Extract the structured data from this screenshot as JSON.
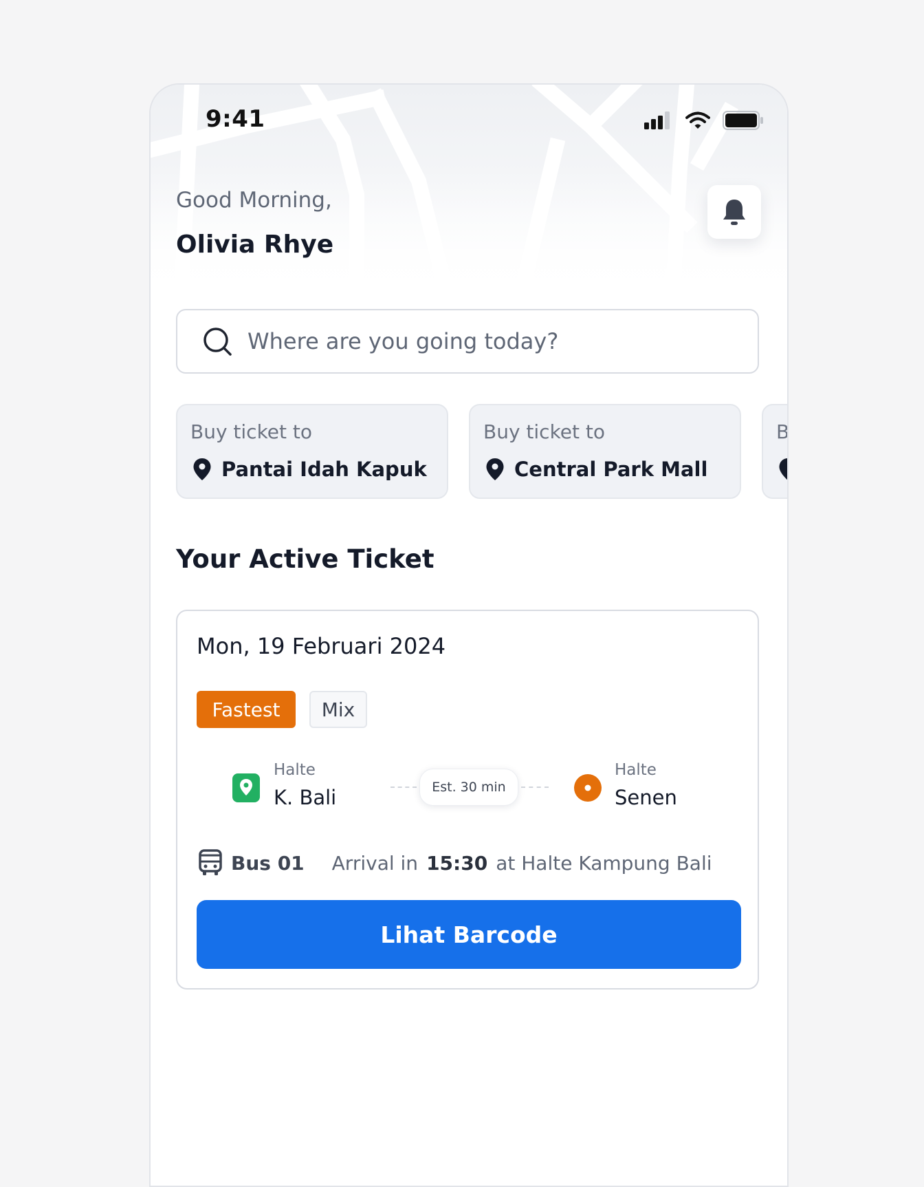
{
  "status_bar": {
    "time": "9:41"
  },
  "header": {
    "greeting": "Good Morning,",
    "user_name": "Olivia Rhye"
  },
  "search": {
    "placeholder": "Where are you going today?"
  },
  "quick_tickets": [
    {
      "caption": "Buy ticket to",
      "destination": "Pantai Idah Kapuk"
    },
    {
      "caption": "Buy ticket to",
      "destination": "Central Park Mall"
    },
    {
      "caption": "B",
      "destination": ""
    }
  ],
  "active_ticket": {
    "section_title": "Your Active Ticket",
    "date": "Mon, 19 Februari 2024",
    "tags": [
      "Fastest",
      "Mix"
    ],
    "from": {
      "label": "Halte",
      "name": "K. Bali"
    },
    "to": {
      "label": "Halte",
      "name": "Senen"
    },
    "estimate": "Est. 30 min",
    "bus": "Bus 01",
    "arrival_prefix": "Arrival in",
    "arrival_time": "15:30",
    "arrival_suffix": "at Halte Kampung Bali",
    "button_label": "Lihat Barcode"
  },
  "colors": {
    "primary": "#1670EA",
    "fastest_tag": "#E46F0A",
    "origin_marker": "#22B062",
    "destination_marker": "#E46F0A"
  }
}
